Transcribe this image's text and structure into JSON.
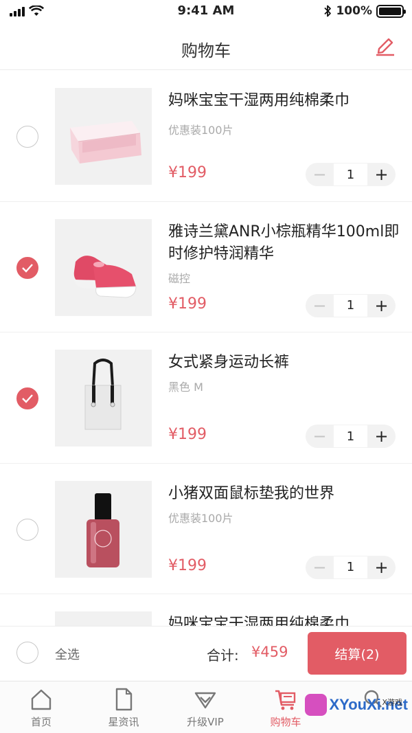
{
  "status_bar": {
    "time": "9:41 AM",
    "battery_text": "100%"
  },
  "nav": {
    "title": "购物车",
    "edit_icon": "edit-pencil-icon"
  },
  "cart": {
    "items": [
      {
        "name": "妈咪宝宝干湿两用纯棉柔巾",
        "spec": "优惠装100片",
        "price": "¥199",
        "quantity": "1",
        "checked": false,
        "image": "wipes-box-image"
      },
      {
        "name": "雅诗兰黛ANR小棕瓶精华100ml即时修护特润精华",
        "spec": "磁控",
        "price": "¥199",
        "quantity": "1",
        "checked": true,
        "image": "pink-shoe-image"
      },
      {
        "name": "女式紧身运动长裤",
        "spec": "黑色 M",
        "price": "¥199",
        "quantity": "1",
        "checked": true,
        "image": "tote-bag-image"
      },
      {
        "name": "小猪双面鼠标垫我的世界",
        "spec": "优惠装100片",
        "price": "¥199",
        "quantity": "1",
        "checked": false,
        "image": "nail-polish-image"
      },
      {
        "name": "妈咪宝宝干湿两用纯棉柔巾",
        "spec": "",
        "price": "",
        "quantity": "",
        "checked": false,
        "image": ""
      }
    ],
    "stepper_minus": "−",
    "stepper_plus": "+"
  },
  "checkout": {
    "select_all_label": "全选",
    "total_label": "合计:",
    "total_value": "¥459",
    "button_label": "结算(2)"
  },
  "tabs": [
    {
      "label": "首页",
      "icon": "home-icon",
      "active": false
    },
    {
      "label": "星资讯",
      "icon": "document-icon",
      "active": false
    },
    {
      "label": "升级VIP",
      "icon": "vip-diamond-icon",
      "active": false
    },
    {
      "label": "购物车",
      "icon": "cart-icon",
      "active": true
    }
  ],
  "watermark": {
    "text": "XYouXi.net",
    "sub": "X游戏"
  },
  "colors": {
    "accent": "#e25c65",
    "muted": "#a9a9a9",
    "divider": "#efefef"
  }
}
